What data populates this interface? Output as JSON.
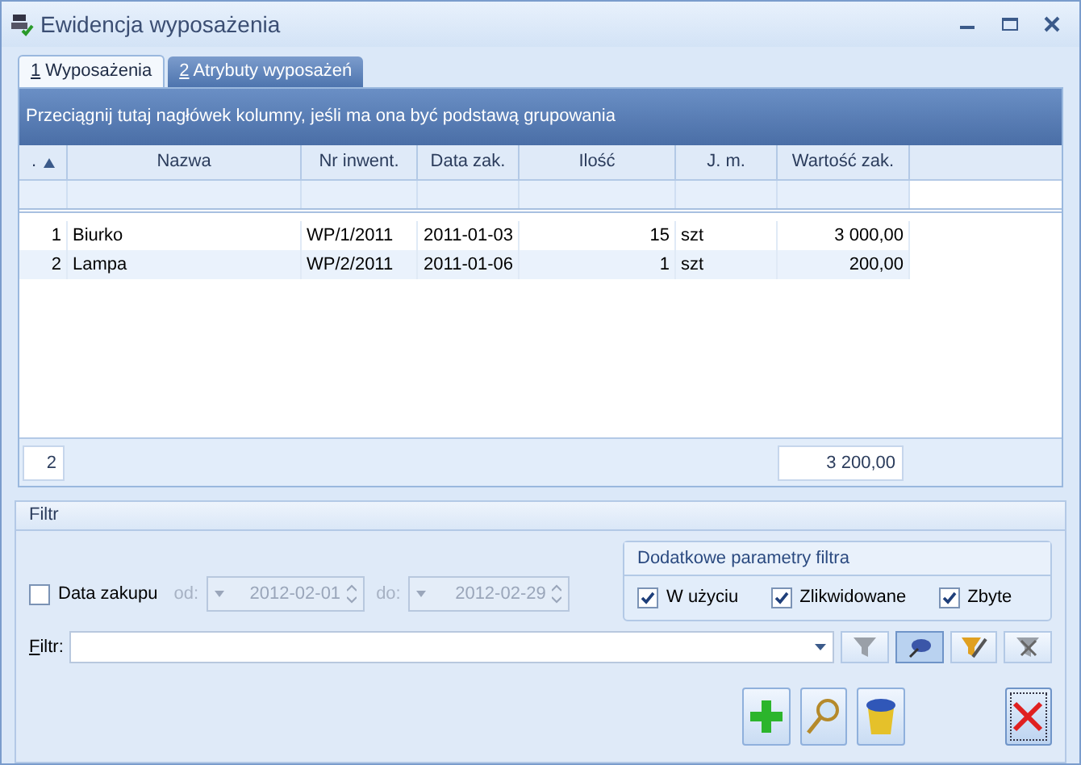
{
  "window": {
    "title": "Ewidencja wyposażenia"
  },
  "tabs": [
    {
      "label": "1 Wyposażenia",
      "selected": true
    },
    {
      "label": "2 Atrybuty wyposażeń",
      "selected": false
    }
  ],
  "group_hint": "Przeciągnij tutaj nagłówek kolumny, jeśli ma ona być podstawą grupowania",
  "columns": [
    {
      "label": "."
    },
    {
      "label": "Nazwa"
    },
    {
      "label": "Nr inwent."
    },
    {
      "label": "Data zak."
    },
    {
      "label": "Ilość"
    },
    {
      "label": "J. m."
    },
    {
      "label": "Wartość zak."
    }
  ],
  "rows": [
    {
      "cells": [
        "1",
        "Biurko",
        "WP/1/2011",
        "2011-01-03",
        "15",
        "szt",
        "3 000,00"
      ]
    },
    {
      "cells": [
        "2",
        "Lampa",
        "WP/2/2011",
        "2011-01-06",
        "1",
        "szt",
        "200,00"
      ]
    }
  ],
  "footer": {
    "count": "2",
    "total": "3 200,00"
  },
  "filter_section": {
    "title": "Filtr"
  },
  "date_filter": {
    "label": "Data zakupu",
    "checked": false,
    "from_label": "od:",
    "from": "2012-02-01",
    "to_label": "do:",
    "to": "2012-02-29"
  },
  "extra_params": {
    "title": "Dodatkowe parametry filtra",
    "options": [
      {
        "label": "W użyciu",
        "checked": true
      },
      {
        "label": "Zlikwidowane",
        "checked": true
      },
      {
        "label": "Zbyte",
        "checked": true
      }
    ]
  },
  "filter": {
    "label": "Filtr:"
  },
  "filter_buttons": [
    {
      "kind": "funnel",
      "pressed": false
    },
    {
      "kind": "pin",
      "pressed": true
    },
    {
      "kind": "funnel-edit",
      "pressed": false
    },
    {
      "kind": "funnel-clear",
      "pressed": false
    }
  ]
}
